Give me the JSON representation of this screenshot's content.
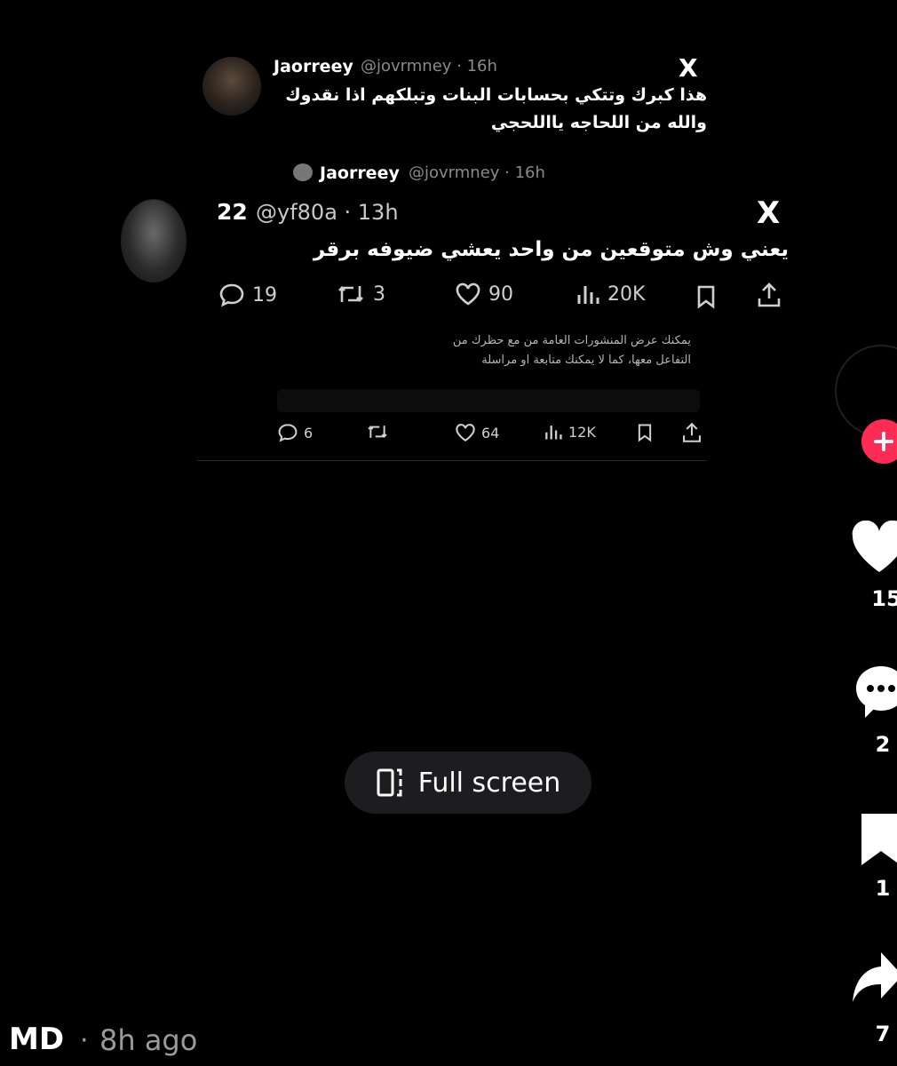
{
  "tweet_main": {
    "author_name": "Jaorreey",
    "handle_time": "@jovrmney · 16h",
    "x_icon": "X",
    "text_line1": "هذا كبرك وتتكي بحسابات البنات وتبلكهم اذا نقدوك",
    "text_line2": "والله من اللحاجه يااللحجي"
  },
  "quoted_header": {
    "author_name": "Jaorreey",
    "handle_time": "@jovrmney · 16h"
  },
  "tweet_reply": {
    "author_name": "22",
    "handle_time": "@yf80a · 13h",
    "x_icon": "X",
    "text": "يعني وش متوقعين من واحد يعشي ضيوفه برقر",
    "replies": "19",
    "reposts": "3",
    "likes": "90",
    "views": "20K"
  },
  "notice": {
    "line1": "يمكنك عرض المنشورات العامة من  مع حظرك من",
    "line2": "التفاعل معها، كما لا يمكنك متابعة او مراسلة"
  },
  "tweet_bottom_stats": {
    "replies": "6",
    "likes": "64",
    "views": "12K"
  },
  "player": {
    "fullscreen_label": "Full screen"
  },
  "rail": {
    "likes": "15",
    "comments": "2",
    "bookmarks": "1",
    "shares": "7",
    "follow_color": "#fe2c55"
  },
  "footer": {
    "author": "MD",
    "separator": "·",
    "time_ago": "8h ago"
  }
}
